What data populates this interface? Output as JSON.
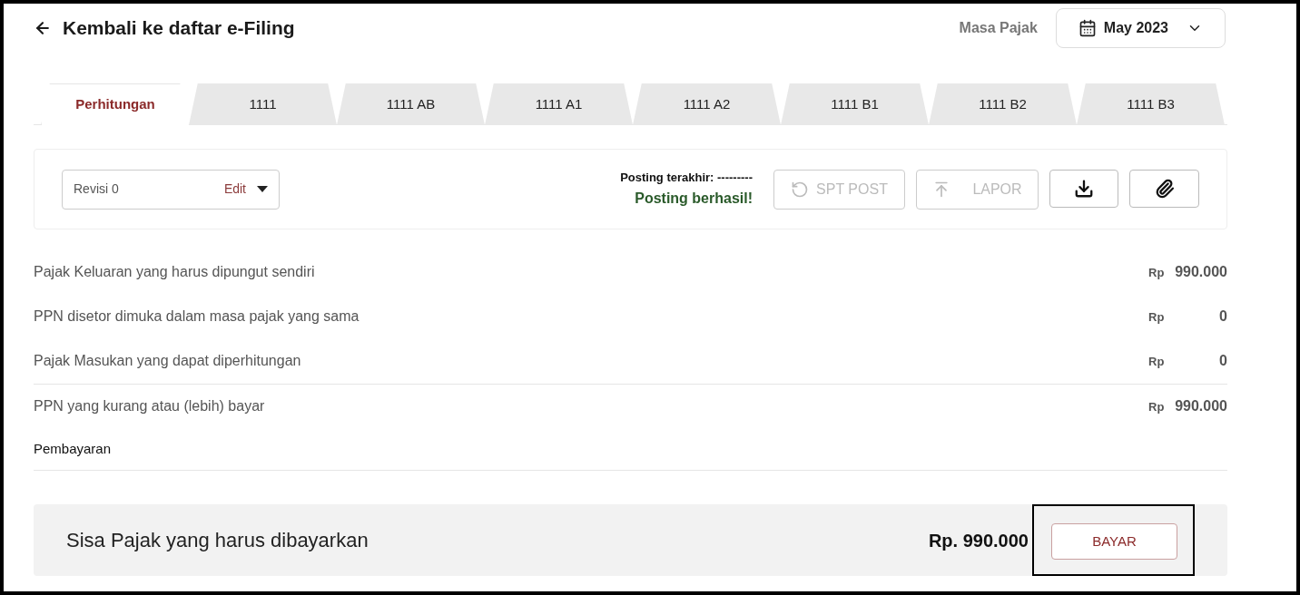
{
  "header": {
    "back_label": "Kembali ke daftar e-Filing",
    "period_label": "Masa Pajak",
    "period_value": "May 2023"
  },
  "tabs": [
    {
      "label": "Perhitungan",
      "selected": true
    },
    {
      "label": "1111",
      "selected": false
    },
    {
      "label": "1111 AB",
      "selected": false
    },
    {
      "label": "1111 A1",
      "selected": false
    },
    {
      "label": "1111 A2",
      "selected": false
    },
    {
      "label": "1111 B1",
      "selected": false
    },
    {
      "label": "1111 B2",
      "selected": false
    },
    {
      "label": "1111 B3",
      "selected": false
    }
  ],
  "toolbar": {
    "revision": "Revisi 0",
    "edit_label": "Edit",
    "last_posting": "Posting terakhir: ---------",
    "status": "Posting berhasil!",
    "buttons": [
      {
        "kind": "spt-post",
        "label": "SPT POST",
        "disabled": true
      },
      {
        "kind": "lapor",
        "label": "LAPOR",
        "disabled": true
      },
      {
        "kind": "download",
        "disabled": false
      },
      {
        "kind": "attach",
        "disabled": false
      }
    ]
  },
  "rows": [
    {
      "label": "Pajak Keluaran yang harus dipungut sendiri",
      "currency": "Rp",
      "amount": "990.000",
      "divider_before": false
    },
    {
      "label": "PPN disetor dimuka dalam masa pajak yang sama",
      "currency": "Rp",
      "amount": "0",
      "divider_before": false
    },
    {
      "label": "Pajak Masukan yang dapat diperhitungan",
      "currency": "Rp",
      "amount": "0",
      "divider_before": false
    },
    {
      "label": "PPN yang kurang atau (lebih) bayar",
      "currency": "Rp",
      "amount": "990.000",
      "divider_before": true
    }
  ],
  "payment": {
    "title": "Pembayaran",
    "summary_label": "Sisa Pajak yang harus dibayarkan",
    "summary_amount": "Rp. 990.000",
    "pay_button": {
      "label": "BAYAR",
      "highlighted": true
    }
  }
}
